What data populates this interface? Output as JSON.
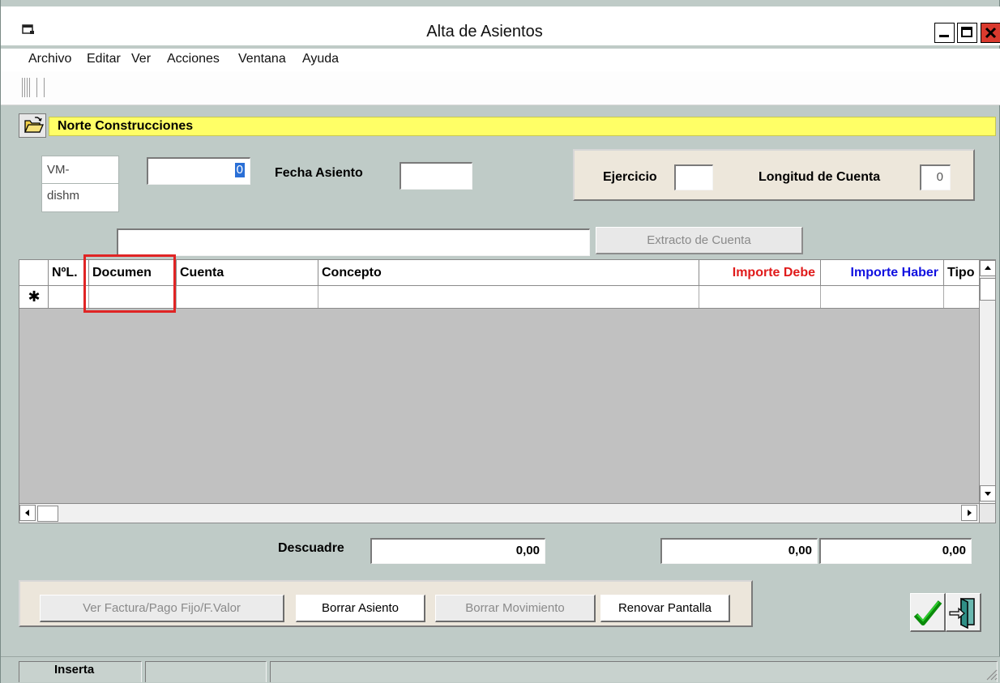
{
  "window": {
    "title": "Alta de Asientos"
  },
  "menu": {
    "items": [
      "Archivo",
      "Editar",
      "Ver",
      "Acciones",
      "Ventana",
      "Ayuda"
    ]
  },
  "company": {
    "name": "Norte Construcciones"
  },
  "header": {
    "vm_line1": "VM-",
    "vm_line2": "dishm",
    "number_value": "0",
    "fecha_label": "Fecha Asiento",
    "fecha_value": "",
    "ejercicio_label": "Ejercicio",
    "ejercicio_value": "",
    "longitud_label": "Longitud de Cuenta",
    "longitud_value": "0",
    "search_value": "",
    "extracto_button": "Extracto de Cuenta"
  },
  "grid": {
    "columns": [
      {
        "label": "",
        "color": "#000000"
      },
      {
        "label": "NºL.",
        "color": "#000000"
      },
      {
        "label": "Documen",
        "color": "#000000"
      },
      {
        "label": "Cuenta",
        "color": "#000000"
      },
      {
        "label": "Concepto",
        "color": "#000000"
      },
      {
        "label": "Importe Debe",
        "color": "#e01b1b"
      },
      {
        "label": "Importe Haber",
        "color": "#1010e0"
      },
      {
        "label": "Tipo",
        "color": "#000000"
      }
    ],
    "new_row_marker": "✱",
    "rows": []
  },
  "totals": {
    "descuadre_label": "Descuadre",
    "descuadre_value": "0,00",
    "debe_total": "0,00",
    "haber_total": "0,00"
  },
  "buttons": {
    "ver_factura": "Ver Factura/Pago Fijo/F.Valor",
    "borrar_asiento": "Borrar Asiento",
    "borrar_movimiento": "Borrar Movimiento",
    "renovar_pantalla": "Renovar Pantalla"
  },
  "status": {
    "mode": "Inserta"
  },
  "icons": {
    "app": "app-window-icon",
    "folder": "open-folder-icon",
    "accept": "checkmark-icon",
    "exit": "exit-door-icon"
  },
  "colors": {
    "company_bar": "#ffff66",
    "highlight": "#e02424",
    "debe": "#e01b1b",
    "haber": "#1010e0"
  }
}
